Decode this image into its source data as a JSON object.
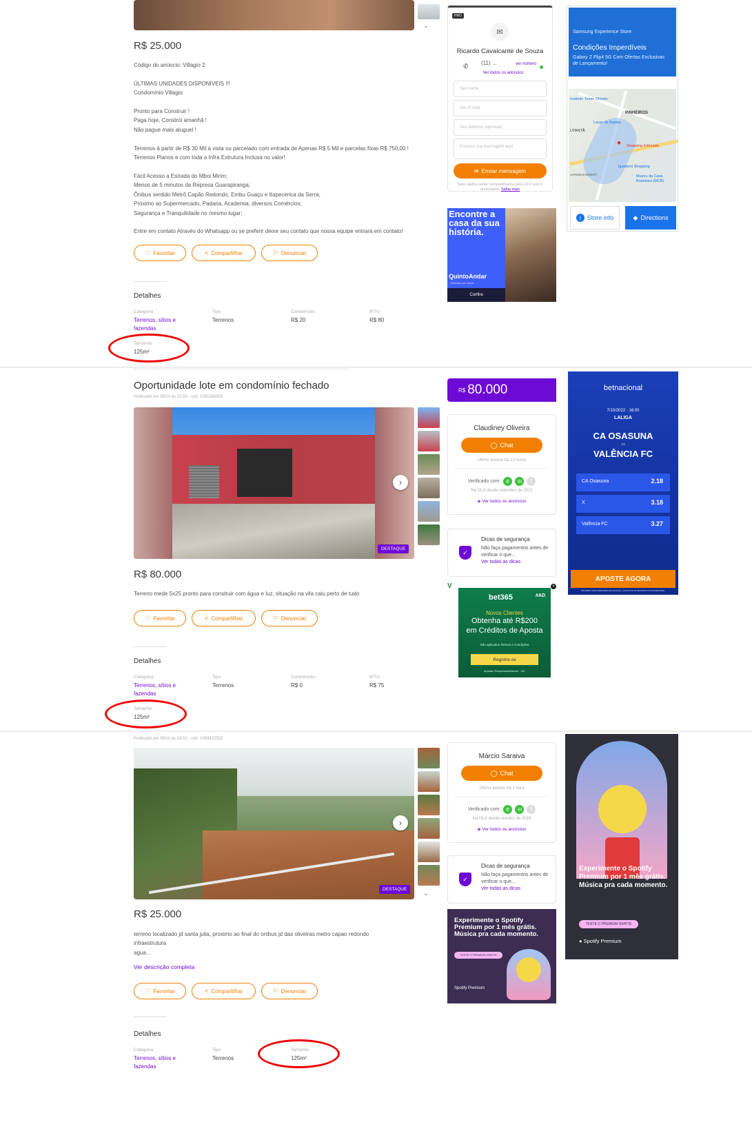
{
  "common": {
    "favoritar": "Favoritar",
    "compartilhar": "Compartilhar",
    "denunciar": "Denunciar",
    "detalhes": "Detalhes",
    "categoria_label": "Categoria",
    "tipo_label": "Tipo",
    "condominio_label": "Condomínio",
    "iptu_label": "IPTU",
    "tamanho_label": "Tamanho",
    "categoria_value": "Terrenos, sítios e fazendas",
    "tipo_value": "Terrenos",
    "destaque": "DESTAQUE",
    "chat": "Chat",
    "verificado": "Verificado com:",
    "ver_todos": "Ver todos os anúncios",
    "dicas_title": "Dicas de segurança",
    "dicas_text": "Não faça pagamentos antes de verificar o que...",
    "dicas_link": "Ver todas as dicas",
    "accent": "#6e0ad6",
    "orange": "#f28000"
  },
  "listing1": {
    "price": "R$ 25.000",
    "description": "Código do anúncio: Villagio 2\n\nÚLTIMAS UNIDADES DISPONÍVEIS !!!\nCondomínio Villagio\n\nPronto para Construir !\nPaga hoje, Constrói amanhã !\nNão pague mais aluguel !\n\nTerrenos à partir de R$ 30 Mil à vista ou parcelado com entrada de Apenas R$ 5 Mil e parcelas fixas R$ 750,00 !\nTerrenos Planos e com toda a Infra Estrutura Inclusa no valor!\n\nFácil Acesso a Estrada do Mboi Mirim;\nMenos de 5 minutos da Represa Guarapiranga;\nÔnibus sentido Metrô Capão Redondo, Embu Guaçu e Itapecerica da Serra;\nPróximo ao Supermercado, Padaria, Academia, diversos Comércios;\nSegurança e Tranquilidade no mesmo lugar;\n\nEntre em contato Através do Whatsapp ou se preferir deixe seu contato que nossa equipe entrará em contato!",
    "condominio": "R$ 20",
    "iptu": "R$ 80",
    "tamanho": "125m²",
    "seller": {
      "pro": "PRO",
      "name": "Ricardo Cavalcante de Souza",
      "phone": "(11) ...",
      "ver_numero": "ver número",
      "ver_todos": "Ver todos os anúncios",
      "field_nome": "Seu nome",
      "field_email": "Seu E-mail",
      "field_tel": "Seu telefone (opcional)",
      "field_msg": "Escreva sua mensagem aqui",
      "send": "Enviar mensagem",
      "privacy": "Seus dados serão compartilhados pela OLX com o anunciante.",
      "saiba_mais": "Saiba mais"
    },
    "ad_quintoandar": {
      "headline": "Encontre a casa da sua história.",
      "brand": "QuintoAndar",
      "tagline": "Histórias pra morar.",
      "cta": "Confira"
    },
    "ad_map": {
      "store": "Samsung Experience Store",
      "headline": "Condições Imperdíveis",
      "sub": "Galaxy Z Flip4 5G Com Ofertas Exclusivas de Lançamento!",
      "place1": "Instituto Tomie Ohtake",
      "place2": "PINHEIROS",
      "place3": "Largo da Batata",
      "place4": "Shopping Eldorado",
      "place5": "Iguatemi Shopping",
      "place6": "Museu da Casa Brasileira (MCB)",
      "place7": "UTANTÃ",
      "place8": "JARDIM EVEREST",
      "store_info": "Store info",
      "directions": "Directions"
    }
  },
  "listing2": {
    "title": "Oportunidade lote em condomínio fechado",
    "published": "Publicado em 08/10 às 21:58 - cód. 1091345659",
    "price": "R$ 80.000",
    "price_badge_currency": "R$",
    "price_badge_value": "80.000",
    "description": "Terreno mede 5x25 pronto para construir com água e luz, situação na vila calu perto de tudo",
    "condominio": "R$ 0",
    "iptu": "R$ 75",
    "tamanho": "125m²",
    "seller": {
      "name": "Claudiney Oliveira",
      "last_access": "Último acesso há 13 horas",
      "since": "Na OLX desde setembro de 2022"
    },
    "ad_bet365": {
      "brand": "bet365",
      "hashtag": "#AD",
      "line1": "Novos Clientes",
      "line2": "Obtenha até R$200",
      "line3": "em Créditos de Aposta",
      "terms": "São aplicados Termos e Condições",
      "cta": "Registre-se",
      "foot": "Apoiado Responsavelmente · 18+"
    },
    "ad_betnacional": {
      "brand": "betnacional",
      "date": "7/10/2022 - 16:00",
      "league": "LALIGA",
      "team1": "CA OSASUNA",
      "vs": "VS",
      "team2": "VALÊNCIA FC",
      "odds": [
        {
          "label": "CA Osasuna",
          "value": "2.18"
        },
        {
          "label": "X",
          "value": "3.18"
        },
        {
          "label": "Valência FC",
          "value": "3.27"
        }
      ],
      "cta": "APOSTE AGORA",
      "foot": "PROIBIDO PARA MENORES DE 18 ANOS. CONSULTE AS REGRAS E AUTORIZAÇÕES."
    }
  },
  "listing3": {
    "published": "Publicado em 08/10 às 13:01 - cód. 1083422522",
    "price": "R$ 25.000",
    "description": "terreno localizado jd santa julia, proximo ao final do onibus jd das oliveiras metro capao redondo\ninfraestrutura\nagua...",
    "ver_descricao": "Ver descrição completa",
    "tamanho": "125m²",
    "seller": {
      "name": "Márcio Saraiva",
      "last_access": "Último acesso há 1 hora",
      "since": "Na OLX desde outubro de 2019"
    },
    "ad_spotify_small": {
      "headline": "Experimente o Spotify Premium por 1 mês grátis. Música pra cada momento.",
      "cta": "TESTE O PREMIUM GRÁTIS",
      "brand": "Spotify Premium"
    },
    "ad_spotify_big": {
      "headline": "Experimente o Spotify Premium por 1 mês grátis. Música pra cada momento.",
      "cta": "TESTE O PREMIUM GRÁTIS",
      "brand": "Spotify Premium"
    }
  }
}
